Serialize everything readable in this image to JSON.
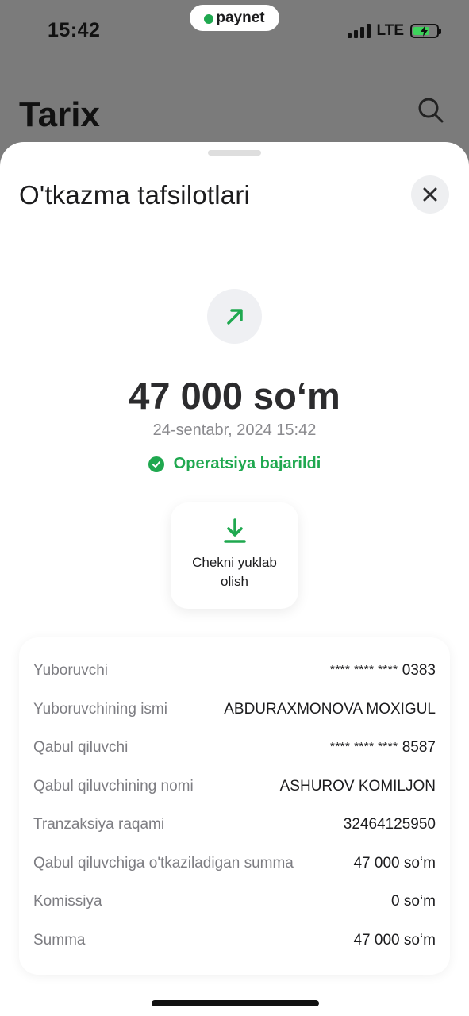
{
  "status_bar": {
    "time": "15:42",
    "network": "LTE"
  },
  "brand": {
    "name": "paynet"
  },
  "background_screen": {
    "title": "Tarix"
  },
  "sheet": {
    "title": "O'tkazma tafsilotlari",
    "amount": "47 000 so‘m",
    "date": "24-sentabr, 2024 15:42",
    "status": "Operatsiya bajarildi",
    "download_button_label": "Chekni yuklab olish"
  },
  "details": [
    {
      "label": "Yuboruvchi",
      "mask": "**** **** ****",
      "value": "0383"
    },
    {
      "label": "Yuboruvchining ismi",
      "mask": "",
      "value": "ABDURAXMONOVA MOXIGUL"
    },
    {
      "label": "Qabul qiluvchi",
      "mask": "**** **** ****",
      "value": "8587"
    },
    {
      "label": "Qabul qiluvchining nomi",
      "mask": "",
      "value": "ASHUROV KOMILJON"
    },
    {
      "label": "Tranzaksiya raqami",
      "mask": "",
      "value": "32464125950"
    },
    {
      "label": "Qabul qiluvchiga o'tkaziladigan summa",
      "mask": "",
      "value": "47 000 so‘m"
    },
    {
      "label": "Komissiya",
      "mask": "",
      "value": "0 so‘m"
    },
    {
      "label": "Summa",
      "mask": "",
      "value": "47 000 so‘m"
    }
  ],
  "colors": {
    "success": "#1fa84f",
    "overlay": "#7b7b7b"
  }
}
